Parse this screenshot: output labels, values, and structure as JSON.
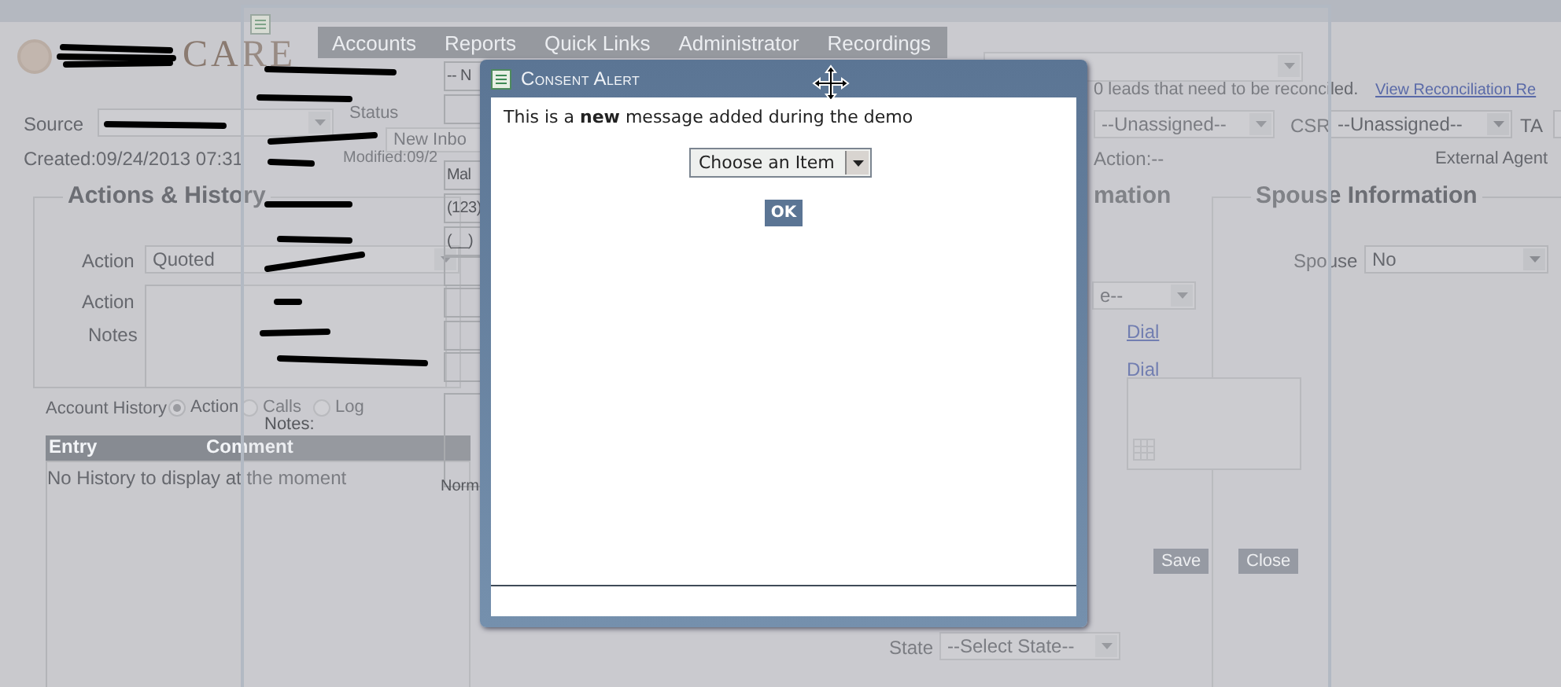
{
  "app": {
    "logo_text": "CARE",
    "nav_tabs": [
      "Accounts",
      "Reports",
      "Quick Links",
      "Administrator",
      "Recordings"
    ],
    "source": {
      "label": "Source"
    },
    "status": {
      "label": "Status",
      "value": "New Inbo"
    },
    "created": "Created:09/24/2013 07:31",
    "modified": "Modified:09/2",
    "actions_history": {
      "title": "Actions & History",
      "action_label": "Action",
      "action_value": "Quoted",
      "notes_label_1": "Action",
      "notes_label_2": "Notes"
    },
    "account_history": {
      "label": "Account History",
      "filters": [
        {
          "label": "Action",
          "selected": true
        },
        {
          "label": "Calls",
          "selected": false
        },
        {
          "label": "Log",
          "selected": false
        }
      ]
    },
    "table": {
      "columns": [
        "Entry",
        "Comment"
      ],
      "empty_message": "No History to display at the moment"
    },
    "reconcile": {
      "message": "0 leads that need to be reconciled.",
      "link": "View Reconciliation Re"
    },
    "assignee_value": "--Unassigned--",
    "csr": {
      "label": "CSR",
      "value": "--Unassigned--"
    },
    "ta": {
      "label": "TA"
    },
    "action_status": "Action:--",
    "external_agent": "External Agent",
    "section_fragment": "mation",
    "spouse_information": {
      "title": "Spouse Information",
      "spouse_label": "Spouse",
      "spouse_value": "No"
    },
    "select_fragment": "e--",
    "dial_links": [
      "Dial",
      "Dial"
    ],
    "save_button": "Save",
    "close_button": "Close",
    "state": {
      "label": "State",
      "value": "--Select State--"
    }
  },
  "form_dialog": {
    "fields": [
      {
        "kind": "input",
        "value": "-- N"
      },
      {
        "kind": "input"
      },
      {
        "kind": "input",
        "value": "Mal"
      },
      {
        "kind": "input",
        "value": "(123)"
      },
      {
        "kind": "input",
        "value": "(__)"
      },
      {
        "kind": "input"
      },
      {
        "kind": "input"
      },
      {
        "kind": "input"
      },
      {
        "kind": "input"
      }
    ],
    "notes_label": "Notes:",
    "fragment": "Norm"
  },
  "consent_alert": {
    "title": "Consent Alert",
    "message": "This is a **new** message added during the demo",
    "select_value": "Choose an Item",
    "ok_button": "OK"
  }
}
